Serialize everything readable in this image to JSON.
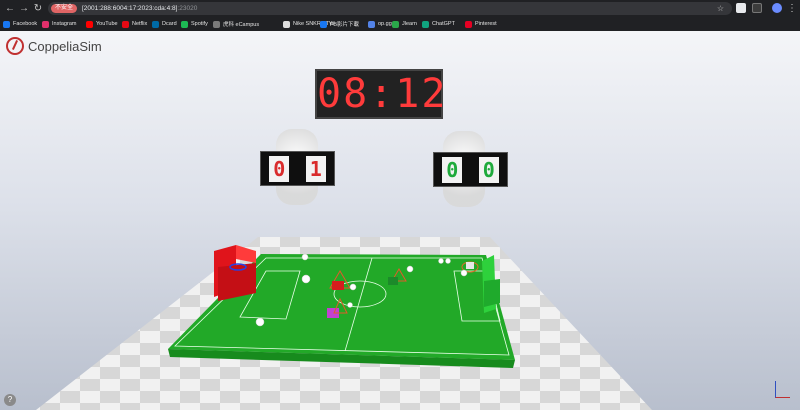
{
  "browser": {
    "security_label": "不安全",
    "url_host": "[2001:288:6004:17:2023:cda:4:8]",
    "url_port": ":23020",
    "bookmarks": [
      {
        "label": "Facebook",
        "color": "#1877f2"
      },
      {
        "label": "Instagram",
        "color": "#e1306c"
      },
      {
        "label": "YouTube",
        "color": "#ff0000"
      },
      {
        "label": "Netflix",
        "color": "#e50914"
      },
      {
        "label": "Dcard",
        "color": "#006aa6"
      },
      {
        "label": "Spotify",
        "color": "#1db954"
      },
      {
        "label": "虎科 eCampus",
        "color": "#7a7a7a"
      },
      {
        "label": "Nike SNKRS TW",
        "color": "#dddddd"
      },
      {
        "label": "FB影片下載",
        "color": "#1877f2"
      },
      {
        "label": "op.gg",
        "color": "#5383e8"
      },
      {
        "label": "Jlearn",
        "color": "#2aa84a"
      },
      {
        "label": "ChatGPT",
        "color": "#10a37f"
      },
      {
        "label": "Pinterest",
        "color": "#e60023"
      }
    ]
  },
  "app": {
    "name": "CoppeliaSim"
  },
  "scene": {
    "timer": "08:12",
    "score_left": {
      "digits": [
        "0",
        "1"
      ],
      "color": "#d92b2b"
    },
    "score_right": {
      "digits": [
        "0",
        "0"
      ],
      "color": "#1faa3b"
    },
    "colors": {
      "field": "#22a928",
      "goal_left": "#e0141b",
      "goal_right": "#2ed13c",
      "timer_led": "#ff3b3b"
    }
  },
  "viewport": {
    "help_label": "?"
  }
}
